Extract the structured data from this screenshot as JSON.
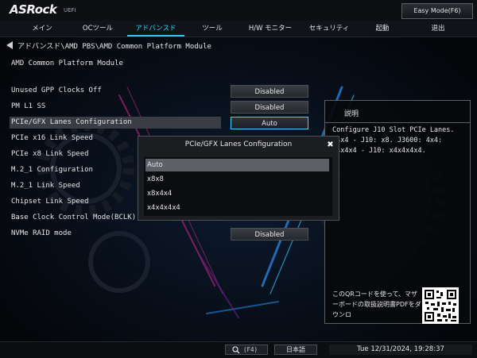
{
  "header": {
    "logo": "ASRock",
    "logo_sub": "UEFI",
    "easy_mode": "Easy Mode(F6)"
  },
  "menu": {
    "items": [
      {
        "label": "メイン"
      },
      {
        "label": "OCツール"
      },
      {
        "label": "アドバンスド",
        "active": true
      },
      {
        "label": "ツール"
      },
      {
        "label": "H/W モニター"
      },
      {
        "label": "セキュリティ"
      },
      {
        "label": "起動"
      },
      {
        "label": "退出"
      }
    ]
  },
  "breadcrumb": "アドバンスド\\AMD PBS\\AMD Common Platform Module",
  "section_title": "AMD Common Platform Module",
  "settings": [
    {
      "label": "Unused GPP Clocks Off",
      "value": "Disabled"
    },
    {
      "label": "PM L1 SS",
      "value": "Disabled"
    },
    {
      "label": "PCIe/GFX Lanes Configuration",
      "value": "Auto"
    },
    {
      "label": "PCIe x16 Link Speed",
      "value": ""
    },
    {
      "label": "PCIe x8 Link Speed",
      "value": ""
    },
    {
      "label": "M.2_1 Configuration",
      "value": ""
    },
    {
      "label": "M.2_1 Link Speed",
      "value": ""
    },
    {
      "label": "Chipset Link Speed",
      "value": ""
    },
    {
      "label": "Base Clock Control Mode(BCLK)",
      "value": ""
    },
    {
      "label": "NVMe RAID mode",
      "value": "Disabled"
    }
  ],
  "help": {
    "title": "説明",
    "text": "Configure J10 Slot PCIe Lanes. x4x4 - J10: x8. J3600: 4x4: x4x4x4 - J10: x4x4x4x4.",
    "qr_text": "このQRコードを使って、マザーボードの取扱説明書PDFをダウンロ"
  },
  "dialog": {
    "title": "PCIe/GFX Lanes Configuration",
    "options": [
      "Auto",
      "x8x8",
      "x8x4x4",
      "x4x4x4x4"
    ],
    "selected": "Auto"
  },
  "footer": {
    "search_key": "(F4)",
    "language": "日本語",
    "datetime": "Tue 12/31/2024, 19:28:37"
  },
  "colors": {
    "accent": "#29c9f4",
    "background": "#05060a",
    "panel": "#1b1d21",
    "selected_option": "#5d6066"
  }
}
